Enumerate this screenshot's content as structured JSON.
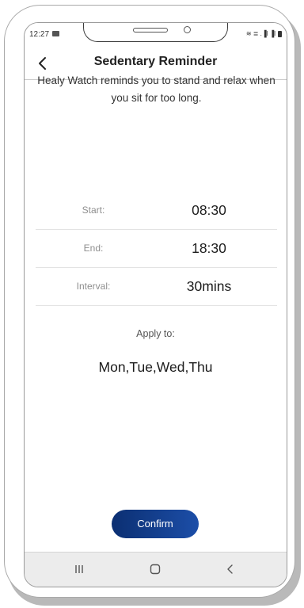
{
  "status_bar": {
    "time": "12:27",
    "right_indicators": "≋ ≣ .▐l ▐l"
  },
  "header": {
    "title": "Sedentary Reminder"
  },
  "description": "Healy Watch reminds you to stand and relax when you sit for too long.",
  "settings": [
    {
      "label": "Start:",
      "value": "08:30"
    },
    {
      "label": "End:",
      "value": "18:30"
    },
    {
      "label": "Interval:",
      "value": "30mins"
    }
  ],
  "apply": {
    "label": "Apply to:",
    "value": "Mon,Tue,Wed,Thu"
  },
  "confirm_label": "Confirm",
  "colors": {
    "confirm_gradient_start": "#0b2f72",
    "confirm_gradient_end": "#1c4ea8",
    "divider": "#e3e3e3",
    "nav_bar": "#ececec"
  },
  "icons": {
    "back": "chevron-left-icon",
    "recents": "recents-icon",
    "home": "home-icon",
    "nav_back": "nav-back-icon"
  }
}
